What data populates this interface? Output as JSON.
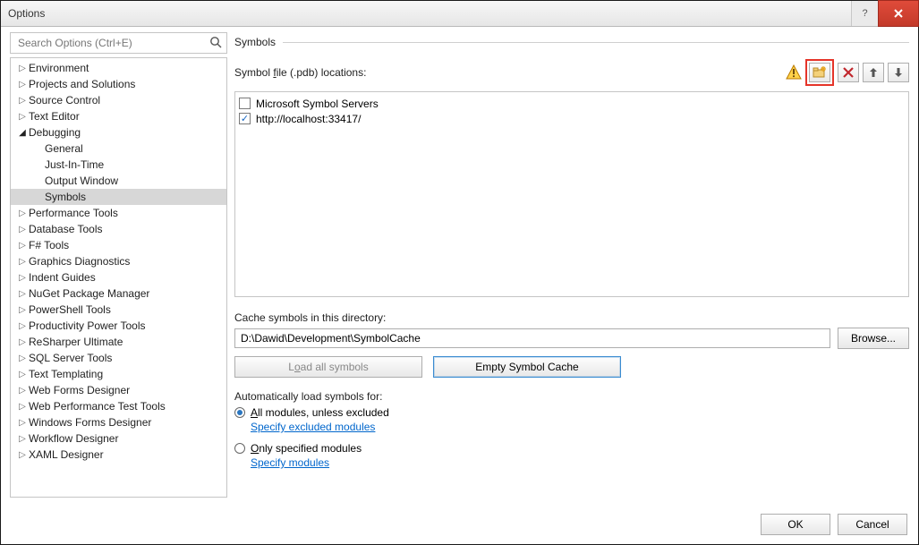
{
  "window": {
    "title": "Options"
  },
  "search": {
    "placeholder": "Search Options (Ctrl+E)"
  },
  "tree": [
    {
      "label": "Environment",
      "depth": 0,
      "arrow": "collapsed"
    },
    {
      "label": "Projects and Solutions",
      "depth": 0,
      "arrow": "collapsed"
    },
    {
      "label": "Source Control",
      "depth": 0,
      "arrow": "collapsed"
    },
    {
      "label": "Text Editor",
      "depth": 0,
      "arrow": "collapsed"
    },
    {
      "label": "Debugging",
      "depth": 0,
      "arrow": "expanded"
    },
    {
      "label": "General",
      "depth": 1,
      "arrow": "none"
    },
    {
      "label": "Just-In-Time",
      "depth": 1,
      "arrow": "none"
    },
    {
      "label": "Output Window",
      "depth": 1,
      "arrow": "none"
    },
    {
      "label": "Symbols",
      "depth": 1,
      "arrow": "none",
      "selected": true
    },
    {
      "label": "Performance Tools",
      "depth": 0,
      "arrow": "collapsed"
    },
    {
      "label": "Database Tools",
      "depth": 0,
      "arrow": "collapsed"
    },
    {
      "label": "F# Tools",
      "depth": 0,
      "arrow": "collapsed"
    },
    {
      "label": "Graphics Diagnostics",
      "depth": 0,
      "arrow": "collapsed"
    },
    {
      "label": "Indent Guides",
      "depth": 0,
      "arrow": "collapsed"
    },
    {
      "label": "NuGet Package Manager",
      "depth": 0,
      "arrow": "collapsed"
    },
    {
      "label": "PowerShell Tools",
      "depth": 0,
      "arrow": "collapsed"
    },
    {
      "label": "Productivity Power Tools",
      "depth": 0,
      "arrow": "collapsed"
    },
    {
      "label": "ReSharper Ultimate",
      "depth": 0,
      "arrow": "collapsed"
    },
    {
      "label": "SQL Server Tools",
      "depth": 0,
      "arrow": "collapsed"
    },
    {
      "label": "Text Templating",
      "depth": 0,
      "arrow": "collapsed"
    },
    {
      "label": "Web Forms Designer",
      "depth": 0,
      "arrow": "collapsed"
    },
    {
      "label": "Web Performance Test Tools",
      "depth": 0,
      "arrow": "collapsed"
    },
    {
      "label": "Windows Forms Designer",
      "depth": 0,
      "arrow": "collapsed"
    },
    {
      "label": "Workflow Designer",
      "depth": 0,
      "arrow": "collapsed"
    },
    {
      "label": "XAML Designer",
      "depth": 0,
      "arrow": "collapsed"
    }
  ],
  "main": {
    "heading": "Symbols",
    "locations_label_pre": "Symbol ",
    "locations_label_key": "f",
    "locations_label_post": "ile (.pdb) locations:",
    "locations": [
      {
        "checked": false,
        "label": "Microsoft Symbol Servers"
      },
      {
        "checked": true,
        "label": "http://localhost:33417/"
      }
    ],
    "cache_label": "Cache symbols in this directory:",
    "cache_path": "D:\\Dawid\\Development\\SymbolCache",
    "browse_label": "Browse...",
    "btn_load_all_pre": "L",
    "btn_load_all_key": "o",
    "btn_load_all_post": "ad all symbols",
    "btn_empty": "Empty Symbol Cache",
    "auto_label": "Automatically load symbols for:",
    "radio_all_key": "A",
    "radio_all_post": "ll modules, unless excluded",
    "link_excluded": "Specify excluded modules",
    "radio_only_key": "O",
    "radio_only_post": "nly specified modules",
    "link_modules": "Specify modules"
  },
  "icons": {
    "warning": "warning-icon",
    "new_folder": "new-folder-icon",
    "delete": "delete-icon",
    "move_up": "arrow-up-icon",
    "move_down": "arrow-down-icon"
  },
  "footer": {
    "ok": "OK",
    "cancel": "Cancel"
  }
}
